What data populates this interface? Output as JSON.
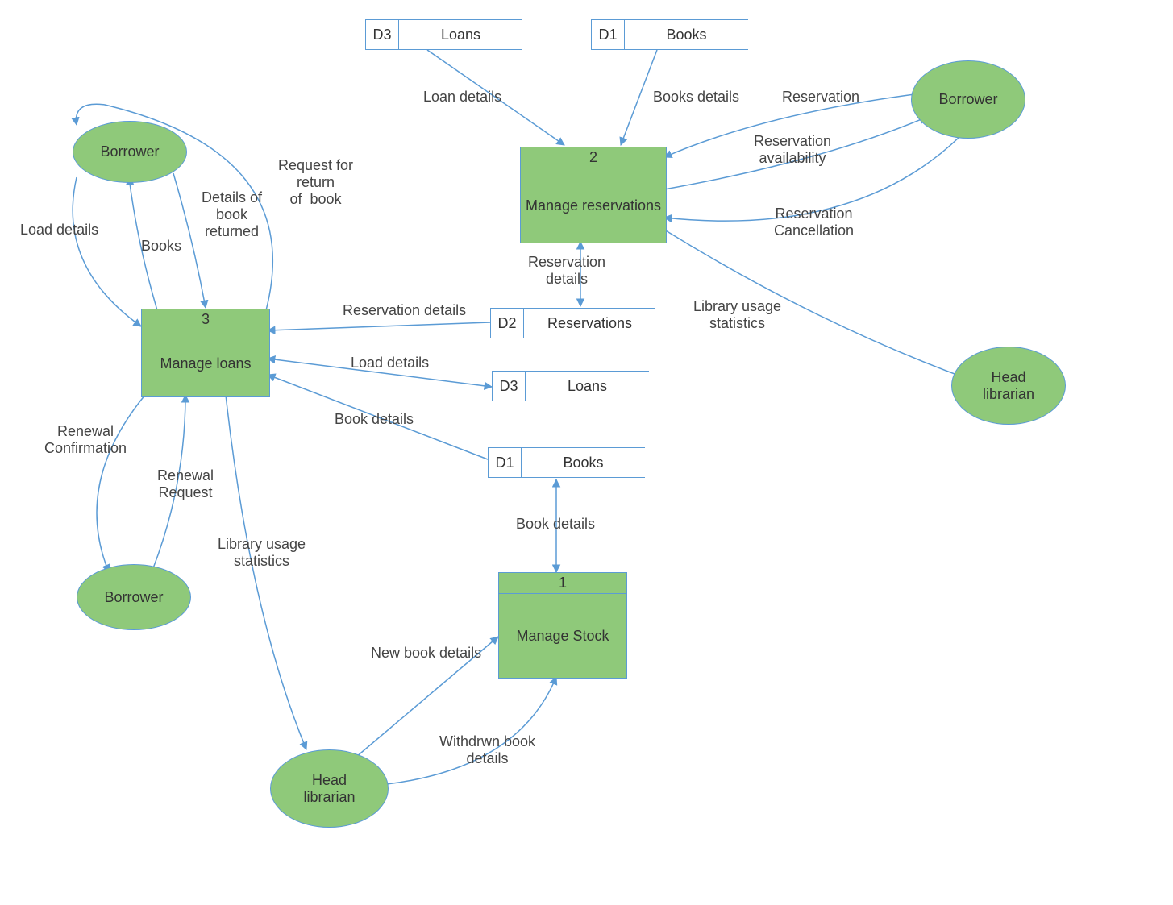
{
  "entities": {
    "borrower_tl": "Borrower",
    "borrower_bl": "Borrower",
    "borrower_tr": "Borrower",
    "headlib_b": "Head\nlibrarian",
    "headlib_r": "Head\nlibrarian"
  },
  "processes": {
    "p1": {
      "num": "1",
      "label": "Manage Stock"
    },
    "p2": {
      "num": "2",
      "label": "Manage\nreservations"
    },
    "p3": {
      "num": "3",
      "label": "Manage loans"
    }
  },
  "datastores": {
    "d3_top": {
      "num": "D3",
      "label": "Loans"
    },
    "d1_top": {
      "num": "D1",
      "label": "Books"
    },
    "d2_mid": {
      "num": "D2",
      "label": "Reservations"
    },
    "d3_mid": {
      "num": "D3",
      "label": "Loans"
    },
    "d1_mid": {
      "num": "D1",
      "label": "Books"
    }
  },
  "flows": {
    "loan_details_top": "Loan details",
    "books_details_top": "Books details",
    "reservation": "Reservation",
    "reservation_avail": "Reservation\navailability",
    "reservation_cancel": "Reservation\nCancellation",
    "reservation_details_v": "Reservation\ndetails",
    "reservation_details_h": "Reservation details",
    "load_details_mid": "Load details",
    "book_details_mid": "Book details",
    "book_details_v": "Book details",
    "new_book_details": "New book details",
    "withdrawn_book_details": "Withdrwn book\ndetails",
    "lib_usage_stats_r": "Library usage\nstatistics",
    "lib_usage_stats_l": "Library usage\nstatistics",
    "load_details_l": "Load details",
    "books_l": "Books",
    "details_returned": "Details of\nbook\nreturned",
    "request_return": "Request for\nreturn\nof  book",
    "renewal_conf": "Renewal\nConfirmation",
    "renewal_req": "Renewal\nRequest"
  }
}
